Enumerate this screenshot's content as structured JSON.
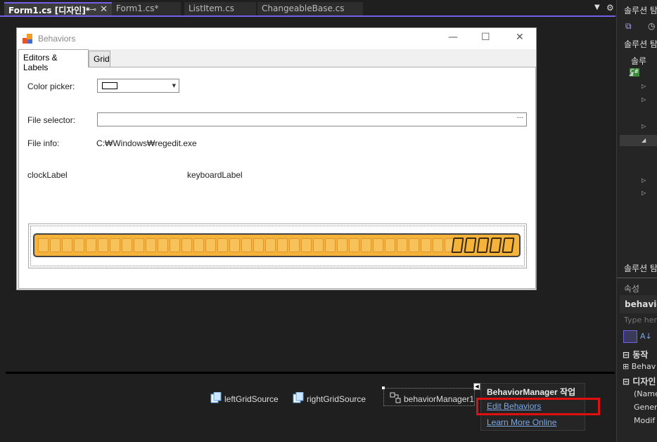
{
  "editor_tabs": [
    {
      "label": "Form1.cs [디자인]*",
      "active": true
    },
    {
      "label": "Form1.cs*",
      "active": false
    },
    {
      "label": "ListItem.cs",
      "active": false
    },
    {
      "label": "ChangeableBase.cs",
      "active": false
    }
  ],
  "form": {
    "title": "Behaviors",
    "tabs": [
      "Editors & Labels",
      "Grid"
    ],
    "color_picker_label": "Color picker:",
    "file_selector_label": "File selector:",
    "file_selector_button": "···",
    "file_info_label": "File info:",
    "file_info_value": "C:₩Windows₩regedit.exe",
    "clock_label": "clockLabel",
    "keyboard_label": "keyboardLabel",
    "minimize": "—",
    "maximize": "☐",
    "close": "✕"
  },
  "tray": {
    "components": [
      "leftGridSource",
      "rightGridSource",
      "behaviorManager1"
    ]
  },
  "smart_tag": {
    "title": "BehaviorManager 작업",
    "edit_link": "Edit Behaviors",
    "learn_link": "Learn More Online"
  },
  "right_panel": {
    "solution_explorer_title": "솔루션 탐",
    "solution_title_2": "솔루션 탐",
    "solution_node": "솔루",
    "solution_explorer_bottom": "솔루션 탐",
    "properties_title": "속성",
    "selected_object": "behavio",
    "search_placeholder": "Type here",
    "category_action": "동작",
    "prop_behaviors": "Behav",
    "category_design": "디자인",
    "prop_name": "(Name",
    "prop_generate": "Genera",
    "prop_modifiers": "Modif"
  },
  "colors": {
    "accent": "#7160e8",
    "led": "#f5b33a",
    "highlight": "#e01010",
    "link": "#7aa9e6"
  }
}
